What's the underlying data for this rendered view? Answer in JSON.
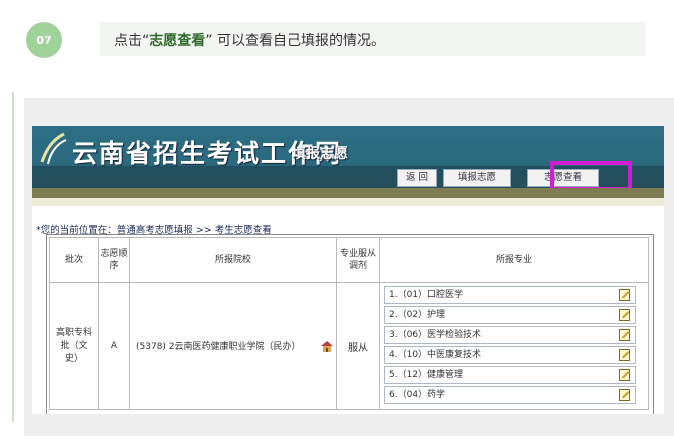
{
  "step": {
    "number": "07",
    "prefix": "点击“",
    "highlight": "志愿查看",
    "suffix": "” 可以查看自己填报的情况。"
  },
  "site": {
    "title": "云南省招生考试工作网",
    "subtitle": "填报志愿",
    "nav": [
      "返  回",
      "填报志愿",
      "志愿查看"
    ]
  },
  "breadcrumb": "*您的当前位置在：普通高考志愿填报 >> 考生志愿查看",
  "table": {
    "headers": {
      "batch": "批次",
      "order": "志愿顺序",
      "school": "所报院校",
      "adjust": "专业服从调剂",
      "majors": "所报专业"
    },
    "row": {
      "batch": "高职专科批（文史）",
      "order": "A",
      "school": "(5378) 2云南医药健康职业学院（民办）",
      "adjust": "服从",
      "majors": [
        "1.（01）口腔医学",
        "2.（02）护理",
        "3.（06）医学检验技术",
        "4.（10）中医康复技术",
        "5.（12）健康管理",
        "6.（04）药学"
      ]
    }
  },
  "colors": {
    "step_circle": "#9fd39a",
    "banner": "#2d6f86",
    "highlight_box": "#d21ccf",
    "olive_bar": "#7e7d52"
  }
}
